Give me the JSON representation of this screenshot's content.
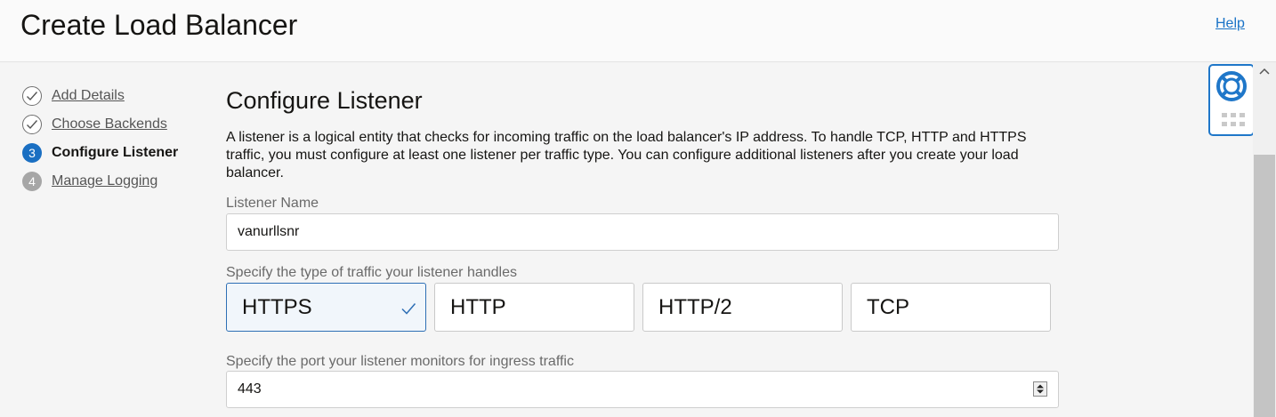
{
  "header": {
    "title": "Create Load Balancer",
    "help_label": "Help"
  },
  "steps": [
    {
      "label": "Add Details",
      "status": "complete",
      "marker": ""
    },
    {
      "label": "Choose Backends",
      "status": "complete",
      "marker": ""
    },
    {
      "label": "Configure Listener",
      "status": "current",
      "marker": "3"
    },
    {
      "label": "Manage Logging",
      "status": "pending",
      "marker": "4"
    }
  ],
  "section": {
    "title": "Configure Listener",
    "description": "A listener is a logical entity that checks for incoming traffic on the load balancer's IP address. To handle TCP, HTTP and HTTPS traffic, you must configure at least one listener per traffic type. You can configure additional listeners after you create your load balancer."
  },
  "listener_name": {
    "label": "Listener Name",
    "value": "vanurllsnr"
  },
  "traffic": {
    "label": "Specify the type of traffic your listener handles",
    "options": [
      "HTTPS",
      "HTTP",
      "HTTP/2",
      "TCP"
    ],
    "selected": "HTTPS"
  },
  "port": {
    "label": "Specify the port your listener monitors for ingress traffic",
    "value": "443"
  },
  "colors": {
    "accent": "#1a6fc2",
    "link": "#1a73c7",
    "selected_border": "#2e6fb5"
  },
  "icons": [
    "check-circle-icon",
    "check-icon",
    "lifebuoy-icon",
    "grid-dots-icon",
    "stepper-icon",
    "chevron-up-icon"
  ]
}
